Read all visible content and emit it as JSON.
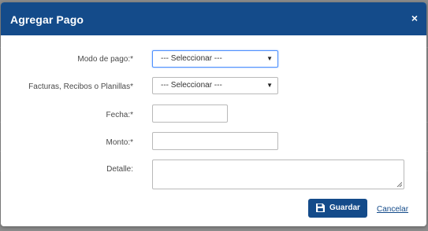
{
  "dialog": {
    "title": "Agregar Pago",
    "close_icon": "close-icon",
    "close_symbol": "×"
  },
  "form": {
    "payment_mode": {
      "label": "Modo de pago:*",
      "selected": "--- Seleccionar ---"
    },
    "invoices": {
      "label": "Facturas, Recibos o Planillas*",
      "selected": "--- Seleccionar ---"
    },
    "date": {
      "label": "Fecha:*",
      "value": ""
    },
    "amount": {
      "label": "Monto:*",
      "value": ""
    },
    "detail": {
      "label": "Detalle:",
      "value": ""
    }
  },
  "actions": {
    "save_label": "Guardar",
    "save_icon": "floppy-icon",
    "cancel_label": "Cancelar"
  },
  "colors": {
    "header_bg": "#144b8a",
    "primary_button": "#144b8a",
    "link": "#144b8a",
    "focus_border": "#4d90fe"
  }
}
